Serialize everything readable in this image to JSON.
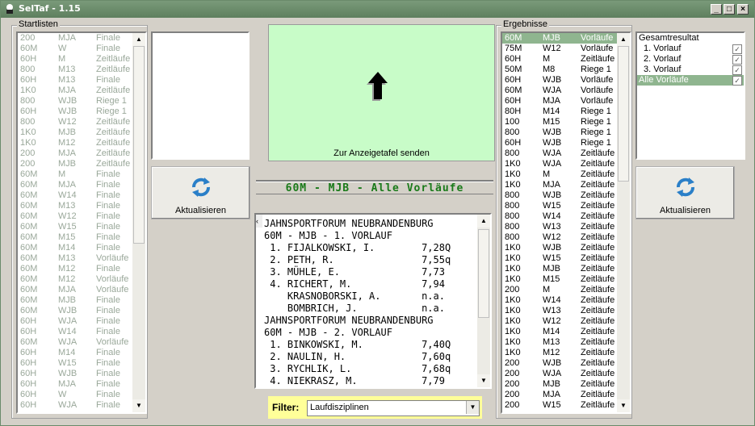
{
  "window": {
    "title": "SelTaf - 1.15"
  },
  "startlisten": {
    "label": "Startlisten",
    "rows": [
      [
        "200",
        "MJA",
        "Finale"
      ],
      [
        "60M",
        "W",
        "Finale"
      ],
      [
        "60H",
        "M",
        "Zeitläufe"
      ],
      [
        "800",
        "M13",
        "Zeitläufe"
      ],
      [
        "60H",
        "M13",
        "Finale"
      ],
      [
        "1K0",
        "MJA",
        "Zeitläufe"
      ],
      [
        "800",
        "WJB",
        "Riege 1"
      ],
      [
        "60H",
        "WJB",
        "Riege 1"
      ],
      [
        "800",
        "W12",
        "Zeitläufe"
      ],
      [
        "1K0",
        "MJB",
        "Zeitläufe"
      ],
      [
        "1K0",
        "M12",
        "Zeitläufe"
      ],
      [
        "200",
        "MJA",
        "Zeitläufe"
      ],
      [
        "200",
        "MJB",
        "Zeitläufe"
      ],
      [
        "60M",
        "M",
        "Finale"
      ],
      [
        "60M",
        "MJA",
        "Finale"
      ],
      [
        "60M",
        "W14",
        "Finale"
      ],
      [
        "60M",
        "M13",
        "Finale"
      ],
      [
        "60M",
        "W12",
        "Finale"
      ],
      [
        "60M",
        "W15",
        "Finale"
      ],
      [
        "60M",
        "M15",
        "Finale"
      ],
      [
        "60M",
        "M14",
        "Finale"
      ],
      [
        "60M",
        "M13",
        "Vorläufe"
      ],
      [
        "60M",
        "M12",
        "Finale"
      ],
      [
        "60M",
        "M12",
        "Vorläufe"
      ],
      [
        "60M",
        "MJA",
        "Vorläufe"
      ],
      [
        "60M",
        "MJB",
        "Finale"
      ],
      [
        "60M",
        "WJB",
        "Finale"
      ],
      [
        "60H",
        "WJA",
        "Finale"
      ],
      [
        "60H",
        "W14",
        "Finale"
      ],
      [
        "60M",
        "WJA",
        "Vorläufe"
      ],
      [
        "60H",
        "M14",
        "Finale"
      ],
      [
        "60H",
        "W15",
        "Finale"
      ],
      [
        "60H",
        "WJB",
        "Finale"
      ],
      [
        "60H",
        "MJA",
        "Finale"
      ],
      [
        "60H",
        "W",
        "Finale"
      ],
      [
        "60H",
        "WJA",
        "Finale"
      ]
    ]
  },
  "left_button": {
    "label": "Aktualisieren"
  },
  "display": {
    "send_label": "Zur Anzeigetafel senden",
    "bg": "#c8fcc8"
  },
  "heading": "60M - MJB - Alle Vorläufe",
  "results_text": [
    "JAHNSPORTFORUM NEUBRANDENBURG",
    "60M - MJB - 1. VORLAUF",
    " 1. FIJALKOWSKI, I.        7,28Q",
    " 2. PETH, R.               7,55q",
    " 3. MÜHLE, E.              7,73",
    " 4. RICHERT, M.            7,94",
    "    KRASNOBORSKI, A.       n.a.",
    "    BOMBRICH, J.           n.a.",
    "JAHNSPORTFORUM NEUBRANDENBURG",
    "60M - MJB - 2. VORLAUF",
    " 1. BINKOWSKI, M.          7,40Q",
    " 2. NAULIN, H.             7,60q",
    " 3. RYCHLIK, L.            7,68q",
    " 4. NIEKRASZ, M.           7,79"
  ],
  "filter": {
    "label": "Filter:",
    "value": "Laufdisziplinen"
  },
  "ergebnisse": {
    "label": "Ergebnisse",
    "rows": [
      [
        "60M",
        "MJB",
        "Vorläufe"
      ],
      [
        "75M",
        "W12",
        "Vorläufe"
      ],
      [
        "60H",
        "M",
        "Zeitläufe"
      ],
      [
        "50M",
        "M8",
        "Riege 1"
      ],
      [
        "60H",
        "WJB",
        "Vorläufe"
      ],
      [
        "60M",
        "WJA",
        "Vorläufe"
      ],
      [
        "60H",
        "MJA",
        "Vorläufe"
      ],
      [
        "80H",
        "M14",
        "Riege 1"
      ],
      [
        "100",
        "M15",
        "Riege 1"
      ],
      [
        "800",
        "WJB",
        "Riege 1"
      ],
      [
        "60H",
        "WJB",
        "Riege 1"
      ],
      [
        "800",
        "WJA",
        "Zeitläufe"
      ],
      [
        "1K0",
        "WJA",
        "Zeitläufe"
      ],
      [
        "1K0",
        "M",
        "Zeitläufe"
      ],
      [
        "1K0",
        "MJA",
        "Zeitläufe"
      ],
      [
        "800",
        "WJB",
        "Zeitläufe"
      ],
      [
        "800",
        "W15",
        "Zeitläufe"
      ],
      [
        "800",
        "W14",
        "Zeitläufe"
      ],
      [
        "800",
        "W13",
        "Zeitläufe"
      ],
      [
        "800",
        "W12",
        "Zeitläufe"
      ],
      [
        "1K0",
        "WJB",
        "Zeitläufe"
      ],
      [
        "1K0",
        "W15",
        "Zeitläufe"
      ],
      [
        "1K0",
        "MJB",
        "Zeitläufe"
      ],
      [
        "1K0",
        "M15",
        "Zeitläufe"
      ],
      [
        "200",
        "M",
        "Zeitläufe"
      ],
      [
        "1K0",
        "W14",
        "Zeitläufe"
      ],
      [
        "1K0",
        "W13",
        "Zeitläufe"
      ],
      [
        "1K0",
        "W12",
        "Zeitläufe"
      ],
      [
        "1K0",
        "M14",
        "Zeitläufe"
      ],
      [
        "1K0",
        "M13",
        "Zeitläufe"
      ],
      [
        "1K0",
        "M12",
        "Zeitläufe"
      ],
      [
        "200",
        "WJB",
        "Zeitläufe"
      ],
      [
        "200",
        "WJA",
        "Zeitläufe"
      ],
      [
        "200",
        "MJB",
        "Zeitläufe"
      ],
      [
        "200",
        "MJA",
        "Zeitläufe"
      ],
      [
        "200",
        "W15",
        "Zeitläufe"
      ]
    ]
  },
  "heats": {
    "items": [
      "Gesamtresultat",
      "1. Vorlauf",
      "2. Vorlauf",
      "3. Vorlauf",
      "Alle Vorläufe"
    ]
  },
  "right_button": {
    "label": "Aktualisieren"
  }
}
